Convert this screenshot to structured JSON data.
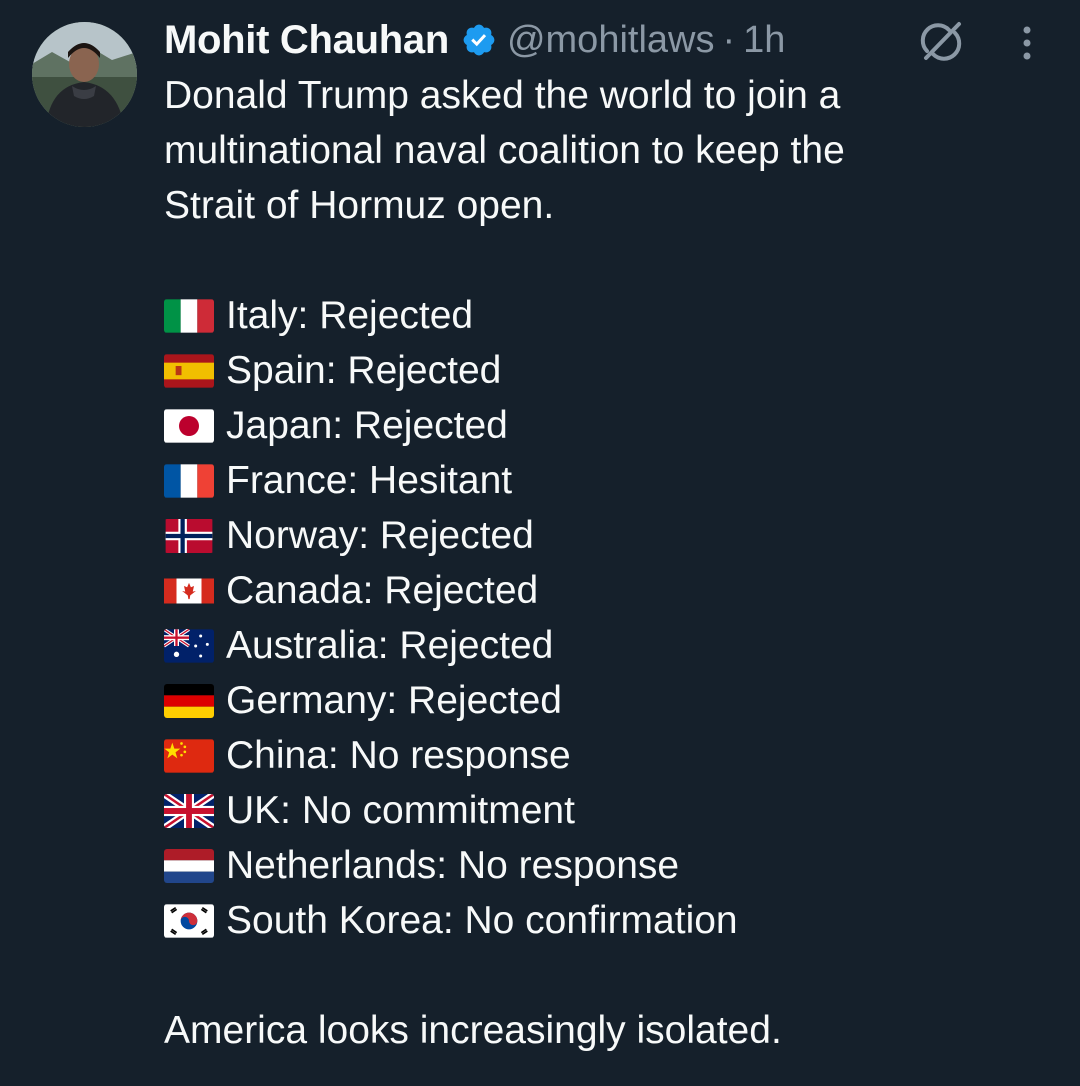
{
  "author": {
    "name": "Mohit Chauhan",
    "handle": "@mohitlaws",
    "separator": "·",
    "time": "1h",
    "avatar_icon": "profile-photo",
    "verified_icon": "verified-badge-icon",
    "verified_color": "#1d9bf0"
  },
  "actions": {
    "grok_icon": "grok-icon",
    "more_icon": "more-vertical-icon"
  },
  "tweet": {
    "intro_lines": [
      "Donald Trump asked the world to join a",
      "multinational naval coalition to keep the",
      "Strait of Hormuz open."
    ],
    "items": [
      {
        "flag": "italy-flag",
        "text": "Italy: Rejected"
      },
      {
        "flag": "spain-flag",
        "text": "Spain: Rejected"
      },
      {
        "flag": "japan-flag",
        "text": "Japan: Rejected"
      },
      {
        "flag": "france-flag",
        "text": "France: Hesitant"
      },
      {
        "flag": "norway-flag",
        "text": "Norway: Rejected"
      },
      {
        "flag": "canada-flag",
        "text": "Canada: Rejected"
      },
      {
        "flag": "australia-flag",
        "text": "Australia: Rejected"
      },
      {
        "flag": "germany-flag",
        "text": "Germany: Rejected"
      },
      {
        "flag": "china-flag",
        "text": "China: No response"
      },
      {
        "flag": "uk-flag",
        "text": "UK: No commitment"
      },
      {
        "flag": "netherlands-flag",
        "text": "Netherlands: No response"
      },
      {
        "flag": "south-korea-flag",
        "text": "South Korea: No confirmation"
      }
    ],
    "outro": "America looks increasingly isolated."
  },
  "colors": {
    "background": "#15202b",
    "text": "#f7f9f9",
    "secondary": "#8b98a5"
  }
}
